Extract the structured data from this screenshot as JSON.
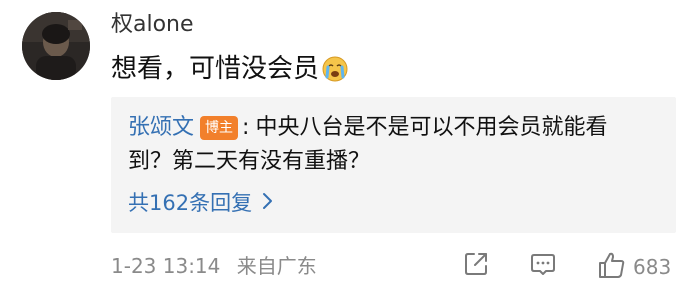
{
  "comment": {
    "username": "权alone",
    "text": "想看，可惜没会员",
    "emoji_icon": "crying-face-icon"
  },
  "reply_preview": {
    "author": "张颂文",
    "badge": "博主",
    "separator": ":",
    "line1": "中央八台是不是可以不用会员就能看",
    "line2": "到？第二天有没有重播？",
    "more_label": "共162条回复"
  },
  "meta": {
    "time": "1-23 13:14",
    "location": "来自广东"
  },
  "actions": {
    "share_icon": "share-icon",
    "reply_icon": "comment-icon",
    "like_icon": "thumbs-up-icon",
    "like_count": "683"
  },
  "colors": {
    "link": "#3470b3",
    "badge": "#f2802b",
    "muted": "#8a8a8a",
    "reply_bg": "#f4f4f4"
  }
}
